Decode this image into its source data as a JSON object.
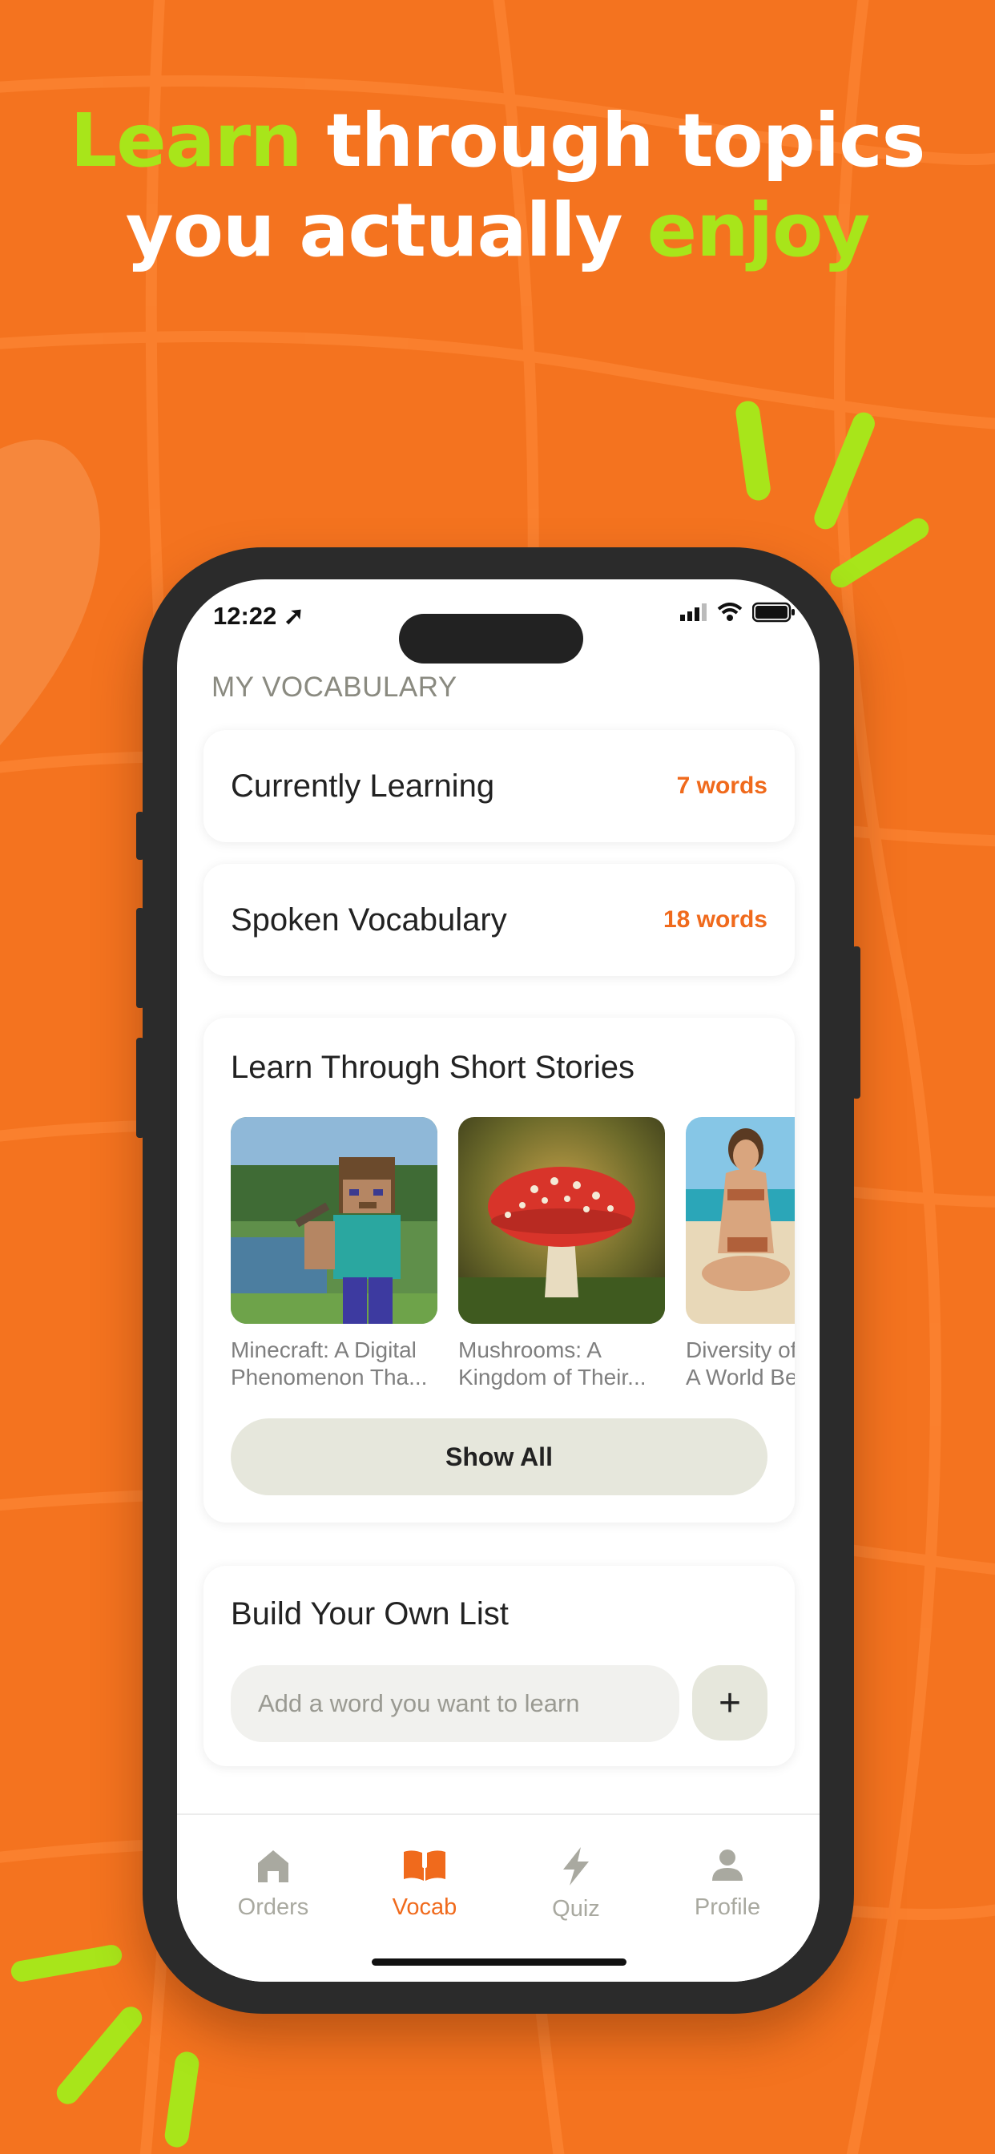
{
  "headline": {
    "line1_accent": "Learn",
    "line1_rest": " through topics",
    "line2_rest": "you actually ",
    "line2_accent": "enjoy"
  },
  "status_bar": {
    "time": "12:22"
  },
  "vocab": {
    "section_title": "MY VOCABULARY",
    "rows": [
      {
        "label": "Currently Learning",
        "count": "7 words"
      },
      {
        "label": "Spoken Vocabulary",
        "count": "18 words"
      }
    ]
  },
  "stories": {
    "heading": "Learn Through Short Stories",
    "items": [
      {
        "line1": "Minecraft: A Digital",
        "line2": "Phenomenon Tha..."
      },
      {
        "line1": "Mushrooms: A",
        "line2": "Kingdom of Their..."
      },
      {
        "line1": "Diversity of",
        "line2": "A World Be"
      }
    ],
    "show_all": "Show All"
  },
  "build_list": {
    "heading": "Build Your Own List",
    "placeholder": "Add a word you want to learn",
    "add_symbol": "+"
  },
  "tabbar": {
    "tabs": [
      {
        "label": "Orders",
        "icon": "home-icon"
      },
      {
        "label": "Vocab",
        "icon": "book-icon",
        "active": true
      },
      {
        "label": "Quiz",
        "icon": "lightning-icon"
      },
      {
        "label": "Profile",
        "icon": "person-icon"
      }
    ]
  },
  "colors": {
    "background": "#f4731f",
    "accent_green": "#a8e51a",
    "accent_orange": "#f06a1c",
    "inactive_tab": "#a9a9a0"
  }
}
